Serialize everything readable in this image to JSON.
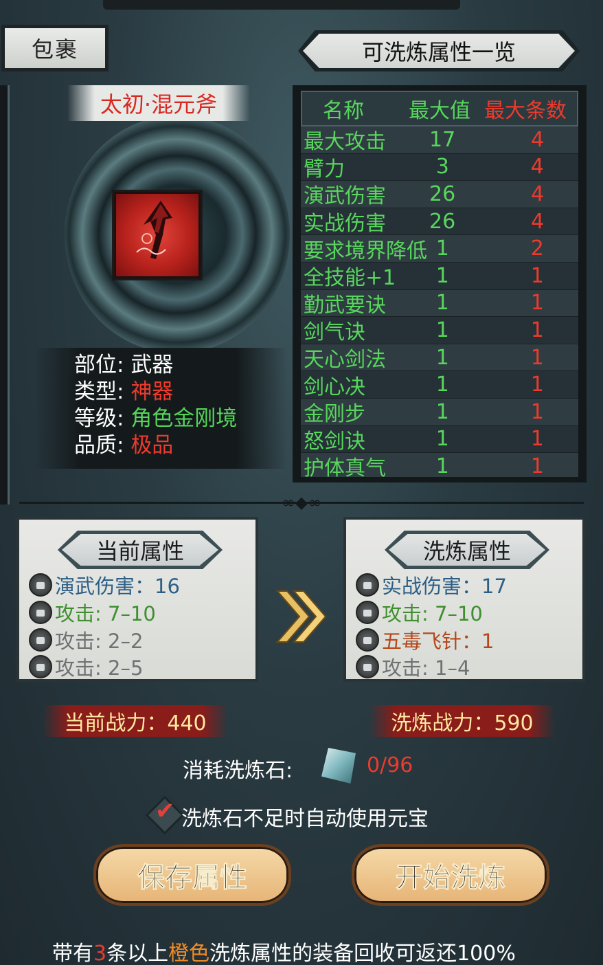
{
  "bag_tab": {
    "label": "包裹"
  },
  "item": {
    "name": "太初·混元斧",
    "info": [
      {
        "label": "部位:",
        "value": "武器",
        "color": "#ffffff"
      },
      {
        "label": "类型:",
        "value": "神器",
        "color": "#ee3a2c"
      },
      {
        "label": "等级:",
        "value": "角色金刚境",
        "color": "#55d55a"
      },
      {
        "label": "品质:",
        "value": "极品",
        "color": "#ee3a2c"
      }
    ]
  },
  "attr_list": {
    "title": "可洗炼属性一览",
    "headers": {
      "name": "名称",
      "max": "最大值",
      "count": "最大条数"
    },
    "rows": [
      {
        "name": "最大攻击",
        "max": "17",
        "count": "4"
      },
      {
        "name": "臂力",
        "max": "3",
        "count": "4"
      },
      {
        "name": "演武伤害",
        "max": "26",
        "count": "4"
      },
      {
        "name": "实战伤害",
        "max": "26",
        "count": "4"
      },
      {
        "name": "要求境界降低",
        "max": "1",
        "count": "2"
      },
      {
        "name": "全技能+1",
        "max": "1",
        "count": "1"
      },
      {
        "name": "勤武要诀",
        "max": "1",
        "count": "1"
      },
      {
        "name": "剑气诀",
        "max": "1",
        "count": "1"
      },
      {
        "name": "天心剑法",
        "max": "1",
        "count": "1"
      },
      {
        "name": "剑心决",
        "max": "1",
        "count": "1"
      },
      {
        "name": "金刚步",
        "max": "1",
        "count": "1"
      },
      {
        "name": "怒剑诀",
        "max": "1",
        "count": "1"
      },
      {
        "name": "护体真气",
        "max": "1",
        "count": "1"
      }
    ]
  },
  "current": {
    "title": "当前属性",
    "attrs": [
      {
        "text": "演武伤害：16",
        "color": "blue"
      },
      {
        "text": "攻击: 7–10",
        "color": "green"
      },
      {
        "text": "攻击: 2–2",
        "color": "gray"
      },
      {
        "text": "攻击: 2–5",
        "color": "gray"
      }
    ],
    "power": "当前战力：440"
  },
  "refined": {
    "title": "洗炼属性",
    "attrs": [
      {
        "text": "实战伤害：17",
        "color": "blue"
      },
      {
        "text": "攻击: 7–10",
        "color": "green"
      },
      {
        "text": "五毒飞针：1",
        "color": "orange"
      },
      {
        "text": "攻击: 1–4",
        "color": "gray"
      }
    ],
    "power": "洗炼战力：590"
  },
  "cost": {
    "label": "消耗洗炼石:",
    "value": "0/96"
  },
  "auto_use": {
    "label": "洗炼石不足时自动使用元宝",
    "checked": true
  },
  "buttons": {
    "save": "保存属性",
    "start": "开始洗炼"
  },
  "footer": {
    "part1": "带有",
    "count": "3",
    "part2": "条以上",
    "color_word": "橙色",
    "part3": "洗炼属性的装备回收可返还100%"
  },
  "icons": [
    "lock-icon",
    "double-arrow-icon",
    "refine-stone-icon",
    "checkbox-icon",
    "axe-icon"
  ]
}
